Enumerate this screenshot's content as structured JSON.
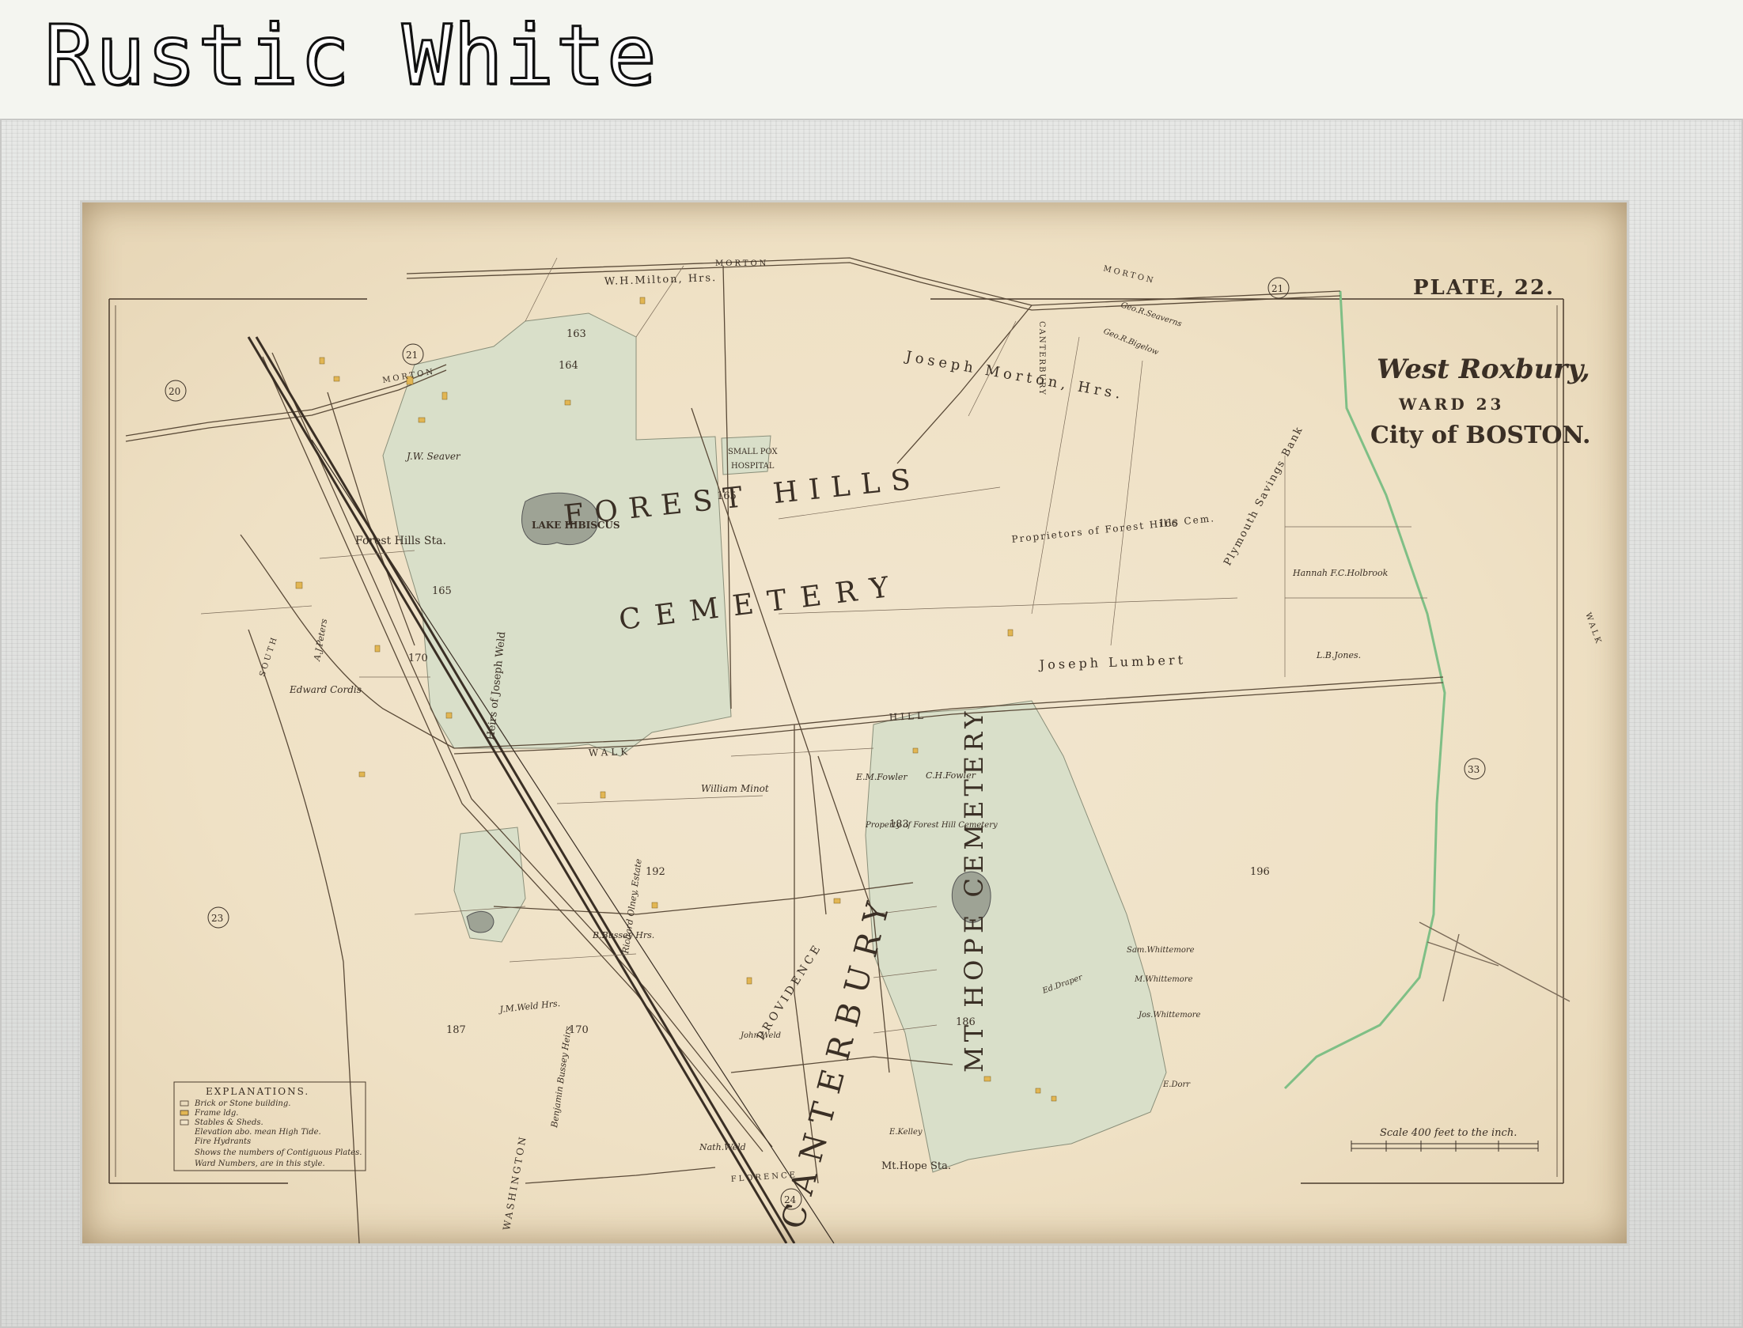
{
  "header": {
    "title": "Rustic White"
  },
  "map": {
    "plate": "PLATE, 22.",
    "title_line1": "West Roxbury,",
    "title_line2": "WARD 23",
    "title_line3": "City of BOSTON.",
    "areas": {
      "forest_hills": "FOREST HILLS",
      "cemetery": "CEMETERY",
      "lake": "LAKE HIBISCUS",
      "mt_hope": "MT HOPE CEMETERY",
      "canterbury": "CANTERBURY",
      "small_pox": "SMALL POX",
      "hospital": "HOSPITAL"
    },
    "streets": {
      "morton_top": "MORTON",
      "morton_right": "MORTON",
      "morton_left": "MORTON",
      "walk_hill": "WALK",
      "hill": "HILL",
      "washington": "WASHINGTON",
      "florence": "FLORENCE",
      "canterbury_st": "CANTERBURY",
      "south": "SOUTH",
      "walk": "WALK",
      "providence": "PROVIDENCE"
    },
    "stations": {
      "forest_hills": "Forest Hills Sta.",
      "mt_hope": "Mt.Hope Sta."
    },
    "owners": {
      "wh_milton": "W.H.Milton, Hrs.",
      "joseph_morton": "Joseph Morton, Hrs.",
      "joseph_lumbert": "Joseph Lumbert",
      "proprietors": "Proprietors of Forest Hills Cem.",
      "plymouth": "Plymouth Savings Bank",
      "hannah": "Hannah F.C.Holbrook",
      "lb_jones": "L.B.Jones.",
      "jw_seaver": "J.W. Seaver",
      "edward_cordis": "Edward Cordis",
      "heirs_weld": "Heirs of Joseph Weld",
      "william_minot": "William Minot",
      "em_fowler": "E.M.Fowler",
      "ch_fowler": "C.H.Fowler",
      "richard_olney": "Richard Olney, Estate",
      "jm_weld": "J.M.Weld Hrs.",
      "benjamin_bussey": "Benjamin Bussey Heirs",
      "john_weld": "John Weld",
      "nath_weld": "Nath.Weld",
      "b_bussey": "B.Bussey Hrs.",
      "sam_whittemore": "Sam.Whittemore",
      "m_whittemore": "M.Whittemore",
      "jos_whittemore": "Jos.Whittemore",
      "e_dorr": "E.Dorr",
      "e_kelley": "E.Kelley",
      "ed_draper": "Ed.Draper",
      "aj_peters": "A.J.Peters",
      "geo_seaverns": "Geo.R.Seaverns",
      "geo_bigelow": "Geo.R.Bigelow",
      "property": "Property of Forest Hill Cemetery"
    },
    "plate_numbers": [
      "20",
      "21",
      "21",
      "23",
      "24",
      "33",
      "163",
      "164",
      "165",
      "165",
      "166",
      "170",
      "170",
      "183",
      "186",
      "187",
      "192",
      "196"
    ],
    "scale_label": "Scale 400 feet to the inch.",
    "legend": {
      "title": "EXPLANATIONS.",
      "items": [
        "Brick or Stone building.",
        "Frame ldg.",
        "Stables & Sheds.",
        "Elevation abo. mean High Tide.",
        "Fire Hydrants",
        "Shows the numbers of Contiguous Plates.",
        "Ward Numbers, are in this style."
      ]
    },
    "colors": {
      "paper": "#f0e3c8",
      "cemetery_fill": "#d9dfc9",
      "ink": "#3a2f25",
      "boundary_green": "#7fbf86"
    }
  }
}
